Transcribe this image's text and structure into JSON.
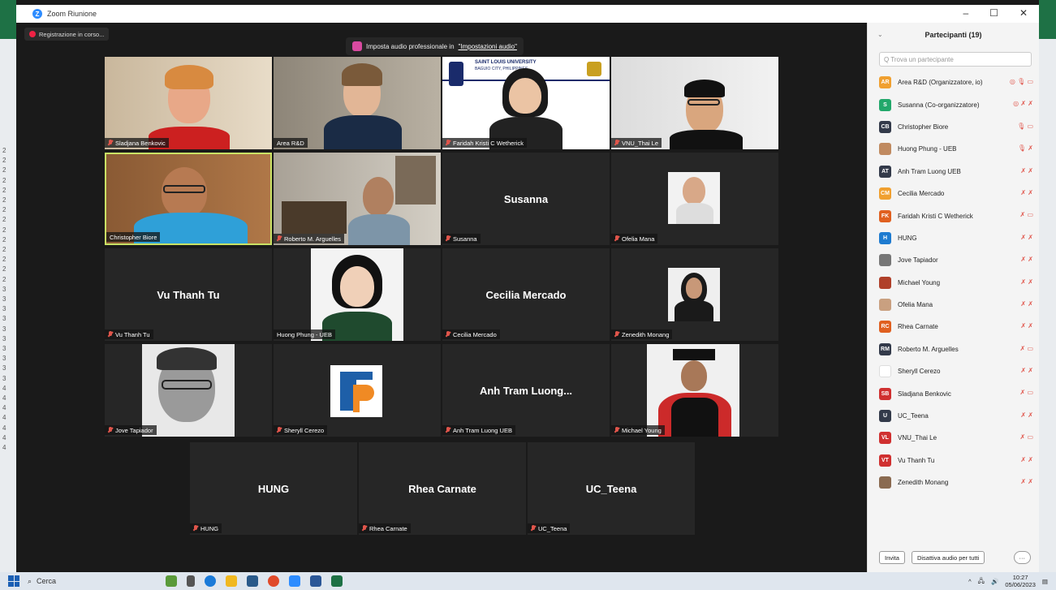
{
  "window": {
    "title": "Zoom Riunione",
    "controls": [
      "–",
      "☐",
      "✕"
    ]
  },
  "recording": {
    "label": "Registrazione in corso..."
  },
  "audio_banner": {
    "prefix": "Imposta audio professionale in ",
    "link": "\"Impostazioni audio\""
  },
  "tiles": [
    {
      "name": "Sladjana Benkovic",
      "muted": true,
      "type": "video"
    },
    {
      "name": "Area R&D",
      "muted": false,
      "type": "video"
    },
    {
      "name": "Faridah Kristi C Wetherick",
      "muted": true,
      "type": "video",
      "banner": "SAINT LOUIS UNIVERSITY",
      "banner_sub": "BAGUIO CITY, PHILIPPINES"
    },
    {
      "name": "VNU_Thai Le",
      "muted": true,
      "type": "video"
    },
    {
      "name": "Christopher Biore",
      "muted": false,
      "type": "video",
      "active": true
    },
    {
      "name": "Roberto M. Arguelles",
      "muted": true,
      "type": "video"
    },
    {
      "name": "Susanna",
      "muted": true,
      "type": "name",
      "display": "Susanna"
    },
    {
      "name": "Ofelia Mana",
      "muted": true,
      "type": "photo"
    },
    {
      "name": "Vu Thanh Tu",
      "muted": true,
      "type": "name",
      "display": "Vu Thanh Tu"
    },
    {
      "name": "Huong Phung - UEB",
      "muted": false,
      "type": "photo"
    },
    {
      "name": "Cecilia Mercado",
      "muted": true,
      "type": "name",
      "display": "Cecilia Mercado"
    },
    {
      "name": "Zenedith Monang",
      "muted": true,
      "type": "photo"
    },
    {
      "name": "Jove Tapiador",
      "muted": true,
      "type": "photo"
    },
    {
      "name": "Sheryll Cerezo",
      "muted": true,
      "type": "logo"
    },
    {
      "name": "Anh Tram Luong UEB",
      "muted": true,
      "type": "name",
      "display": "Anh Tram Luong..."
    },
    {
      "name": "Michael Young",
      "muted": true,
      "type": "photo"
    },
    {
      "name": "HUNG",
      "muted": true,
      "type": "name",
      "display": "HUNG"
    },
    {
      "name": "Rhea Carnate",
      "muted": true,
      "type": "name",
      "display": "Rhea Carnate"
    },
    {
      "name": "UC_Teena",
      "muted": true,
      "type": "name",
      "display": "UC_Teena"
    }
  ],
  "participants_panel": {
    "title": "Partecipanti (19)",
    "search_placeholder": "Q Trova un partecipante",
    "participants": [
      {
        "initials": "AR",
        "color": "#f0a030",
        "name": "Area R&D (Organizzatore, io)",
        "icons": "◎ 🎙 ▭"
      },
      {
        "initials": "S",
        "color": "#22a86b",
        "name": "Susanna (Co-organizzatore)",
        "icons": "◎ ✗ ✗"
      },
      {
        "initials": "CB",
        "color": "#333a4a",
        "name": "Christopher Biore",
        "icons": "🎙 ▭"
      },
      {
        "initials": "",
        "color": "#c08a60",
        "name": "Huong Phung - UEB",
        "icons": "🎙 ✗"
      },
      {
        "initials": "AT",
        "color": "#333a4a",
        "name": "Anh Tram Luong UEB",
        "icons": "✗ ✗"
      },
      {
        "initials": "CM",
        "color": "#f0a030",
        "name": "Cecilia Mercado",
        "icons": "✗ ✗"
      },
      {
        "initials": "FK",
        "color": "#e06020",
        "name": "Faridah Kristi C Wetherick",
        "icons": "✗ ▭"
      },
      {
        "initials": "H",
        "color": "#1e7bd0",
        "name": "HUNG",
        "icons": "✗ ✗"
      },
      {
        "initials": "",
        "color": "#777",
        "name": "Jove Tapiador",
        "icons": "✗ ✗"
      },
      {
        "initials": "",
        "color": "#b0402a",
        "name": "Michael Young",
        "icons": "✗ ✗"
      },
      {
        "initials": "",
        "color": "#c9a080",
        "name": "Ofelia Mana",
        "icons": "✗ ✗"
      },
      {
        "initials": "RC",
        "color": "#e06020",
        "name": "Rhea Carnate",
        "icons": "✗ ✗"
      },
      {
        "initials": "RM",
        "color": "#333a4a",
        "name": "Roberto M. Arguelles",
        "icons": "✗ ▭"
      },
      {
        "initials": "",
        "color": "#ffffff",
        "name": "Sheryll Cerezo",
        "icons": "✗ ✗"
      },
      {
        "initials": "SB",
        "color": "#d03030",
        "name": "Sladjana Benkovic",
        "icons": "✗ ▭"
      },
      {
        "initials": "U",
        "color": "#333a4a",
        "name": "UC_Teena",
        "icons": "✗ ✗"
      },
      {
        "initials": "VL",
        "color": "#d03030",
        "name": "VNU_Thai Le",
        "icons": "✗ ▭"
      },
      {
        "initials": "VT",
        "color": "#d03030",
        "name": "Vu Thanh Tu",
        "icons": "✗ ✗"
      },
      {
        "initials": "",
        "color": "#8a6a50",
        "name": "Zenedith Monang",
        "icons": "✗ ✗"
      }
    ],
    "invite_label": "Invita",
    "mute_all_label": "Disattiva audio per tutti",
    "more_label": "···"
  },
  "taskbar": {
    "search_label": "Cerca",
    "time": "10:27",
    "date": "05/06/2023"
  }
}
